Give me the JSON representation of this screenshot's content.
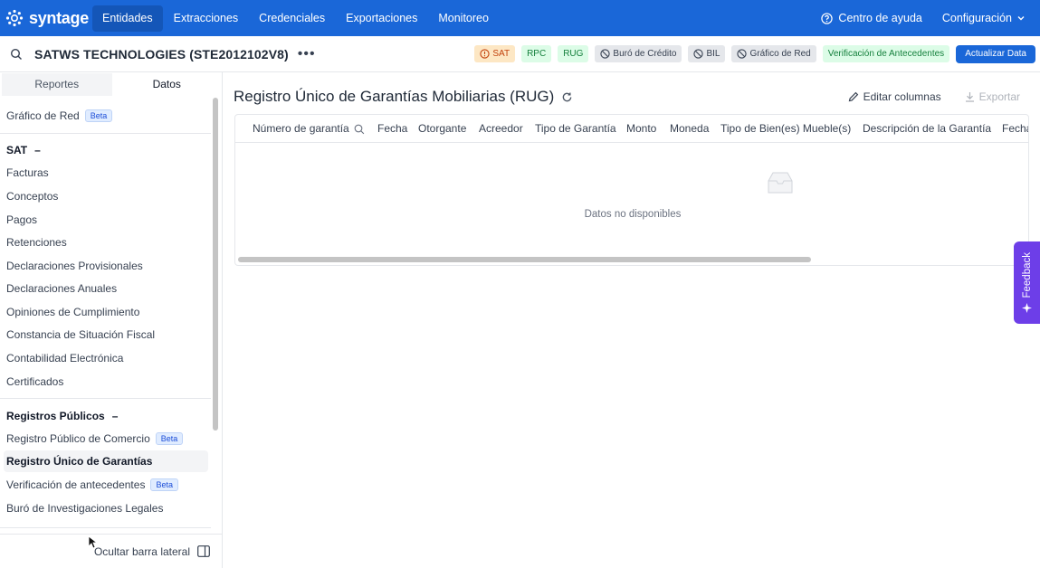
{
  "app": {
    "brand": "syntage"
  },
  "nav": {
    "items": [
      {
        "label": "Entidades",
        "active": true
      },
      {
        "label": "Extracciones",
        "active": false
      },
      {
        "label": "Credenciales",
        "active": false
      },
      {
        "label": "Exportaciones",
        "active": false
      },
      {
        "label": "Monitoreo",
        "active": false
      }
    ],
    "help": "Centro de ayuda",
    "config": "Configuración"
  },
  "entity": {
    "name": "SATWS TECHNOLOGIES (STE2012102V8)",
    "more_icon": "ellipsis-icon"
  },
  "badges": {
    "sat": "SAT",
    "rpc": "RPC",
    "rug": "RUG",
    "buro": "Buró de Crédito",
    "bil": "BIL",
    "grafico": "Gráfico de Red",
    "verificacion": "Verificación de Antecedentes",
    "update": "Actualizar Data"
  },
  "sidebar": {
    "tabs": {
      "reportes": "Reportes",
      "datos": "Datos"
    },
    "grafico": {
      "label": "Gráfico de Red",
      "badge": "Beta"
    },
    "sat_header": "SAT",
    "sat_items": [
      "Facturas",
      "Conceptos",
      "Pagos",
      "Retenciones",
      "Declaraciones Provisionales",
      "Declaraciones Anuales",
      "Opiniones de Cumplimiento",
      "Constancia de Situación Fiscal",
      "Contabilidad Electrónica",
      "Certificados"
    ],
    "registros_header": "Registros Públicos",
    "registros_items": [
      {
        "label": "Registro Público de Comercio",
        "badge": "Beta"
      },
      {
        "label": "Registro Único de Garantías",
        "badge": ""
      },
      {
        "label": "Verificación de antecedentes",
        "badge": "Beta"
      },
      {
        "label": "Buró de Investigaciones Legales",
        "badge": ""
      }
    ],
    "hide": "Ocultar barra lateral"
  },
  "main": {
    "title": "Registro Único de Garantías Mobiliarias (RUG)",
    "edit_columns": "Editar columnas",
    "export": "Exportar",
    "columns": [
      "Número de garantía",
      "Fecha",
      "Otorgante",
      "Acreedor",
      "Tipo de Garantía",
      "Monto",
      "Moneda",
      "Tipo de Bien(es) Mueble(s)",
      "Descripción de la Garantía",
      "Fecha"
    ],
    "empty": "Datos no disponibles"
  },
  "feedback": "Feedback",
  "colors": {
    "primary": "#1a67d8",
    "feedback": "#6d3ee8"
  }
}
